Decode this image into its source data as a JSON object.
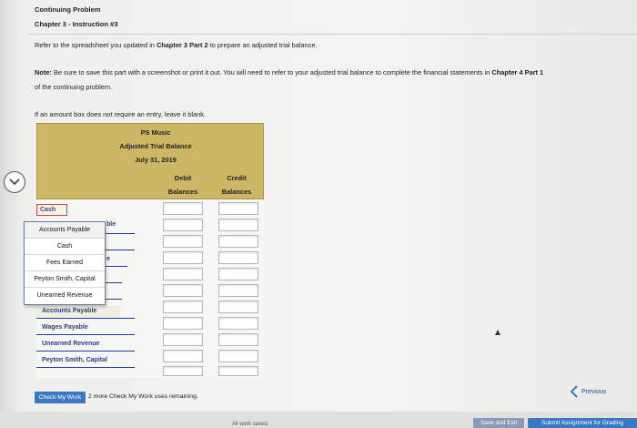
{
  "header": {
    "title": "Continuing Problem",
    "chapter": "Chapter 3 - Instruction #3"
  },
  "instructions": {
    "refer_prefix": "Refer to the spreadsheet you updated in ",
    "refer_bold": "Chapter 3 Part 2",
    "refer_suffix": " to prepare an adjusted trial balance.",
    "note_label": "Note:",
    "note_text": " Be sure to save this part with a screenshot or print it out. You will need to refer to your adjusted trial balance to complete the financial statements in ",
    "note_bold": "Chapter 4 Part 1",
    "note_line2": "of the continuing problem.",
    "if_blank": "If an amount box does not require an entry, leave it blank."
  },
  "sheet": {
    "company": "PS Music",
    "title": "Adjusted Trial Balance",
    "date": "July 31, 2019",
    "col_debit_1": "Debit",
    "col_debit_2": "Balances",
    "col_credit_1": "Credit",
    "col_credit_2": "Balances",
    "selected_account": "Cash",
    "partial_labels": {
      "row2": "ble",
      "row4": "e"
    },
    "rows_below": [
      "Accounts Payable",
      "Wages Payable",
      "Unearned Revenue",
      "Peyton Smith, Capital"
    ]
  },
  "dropdown": {
    "options": [
      "Accounts Payable",
      "Cash",
      "Fees Earned",
      "Peyton Smith, Capital",
      "Unearned Revenue"
    ]
  },
  "footer": {
    "check_label": "Check My Work",
    "remaining": "2 more Check My Work uses remaining.",
    "previous": "Previous",
    "save_exit": "Save and Exit",
    "submit": "Submit Assignment for Grading",
    "all_work": "All work saved."
  },
  "colors": {
    "accent": "#3a78c4",
    "sheet_header": "#cdb765",
    "account_text": "#2a3c8a"
  }
}
